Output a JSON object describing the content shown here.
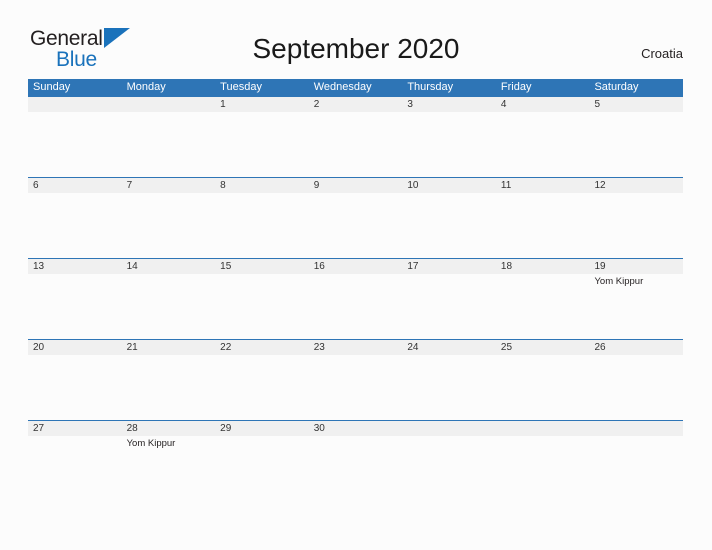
{
  "logo": {
    "word_top": "General",
    "word_bottom": "Blue",
    "flag_icon": "triangle-flag-icon",
    "brand_color": "#1a72bb"
  },
  "header": {
    "title": "September 2020",
    "country": "Croatia"
  },
  "colors": {
    "header_blue": "#2e75b6",
    "date_band_gray": "#f0f0f0",
    "page_background": "#fcfcfc",
    "text_dark": "#231f20"
  },
  "calendar": {
    "weekday_names": [
      "Sunday",
      "Monday",
      "Tuesday",
      "Wednesday",
      "Thursday",
      "Friday",
      "Saturday"
    ],
    "weeks": [
      {
        "dates": [
          "",
          "",
          "1",
          "2",
          "3",
          "4",
          "5"
        ],
        "events": [
          "",
          "",
          "",
          "",
          "",
          "",
          ""
        ]
      },
      {
        "dates": [
          "6",
          "7",
          "8",
          "9",
          "10",
          "11",
          "12"
        ],
        "events": [
          "",
          "",
          "",
          "",
          "",
          "",
          ""
        ]
      },
      {
        "dates": [
          "13",
          "14",
          "15",
          "16",
          "17",
          "18",
          "19"
        ],
        "events": [
          "",
          "",
          "",
          "",
          "",
          "",
          "Yom Kippur"
        ]
      },
      {
        "dates": [
          "20",
          "21",
          "22",
          "23",
          "24",
          "25",
          "26"
        ],
        "events": [
          "",
          "",
          "",
          "",
          "",
          "",
          ""
        ]
      },
      {
        "dates": [
          "27",
          "28",
          "29",
          "30",
          "",
          "",
          ""
        ],
        "events": [
          "",
          "Yom Kippur",
          "",
          "",
          "",
          "",
          ""
        ]
      }
    ]
  }
}
